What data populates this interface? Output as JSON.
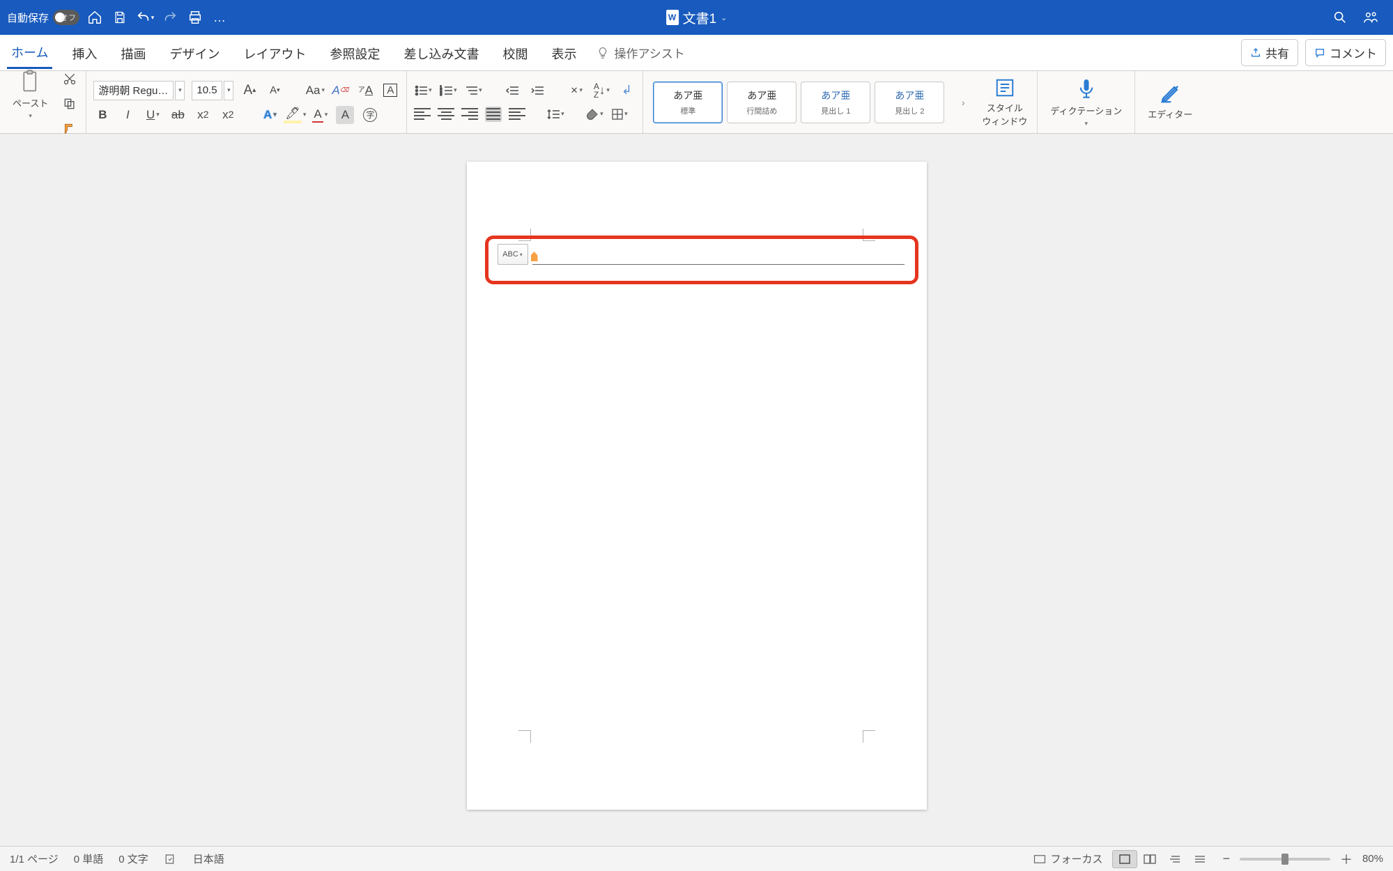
{
  "titlebar": {
    "auto_save_label": "自動保存",
    "auto_save_state": "オフ",
    "document_name": "文書1"
  },
  "tabs": {
    "home": "ホーム",
    "insert": "挿入",
    "draw": "描画",
    "design": "デザイン",
    "layout": "レイアウト",
    "references": "参照設定",
    "mailings": "差し込み文書",
    "review": "校閲",
    "view": "表示",
    "tell_me": "操作アシスト",
    "share": "共有",
    "comment": "コメント"
  },
  "ribbon": {
    "paste": "ペースト",
    "font_name": "游明朝 Regu…",
    "font_size": "10.5",
    "styles": [
      {
        "preview": "あア亜",
        "name": "標準"
      },
      {
        "preview": "あア亜",
        "name": "行間詰め"
      },
      {
        "preview": "あア亜",
        "name": "見出し 1"
      },
      {
        "preview": "あア亜",
        "name": "見出し 2"
      }
    ],
    "style_pane": "スタイル\nウィンドウ",
    "dictation": "ディクテーション",
    "editor": "エディター"
  },
  "paste_tag_text": "ABC",
  "status": {
    "page": "1/1 ページ",
    "words": "0 単語",
    "chars": "0 文字",
    "lang": "日本語",
    "focus": "フォーカス",
    "zoom": "80%"
  }
}
